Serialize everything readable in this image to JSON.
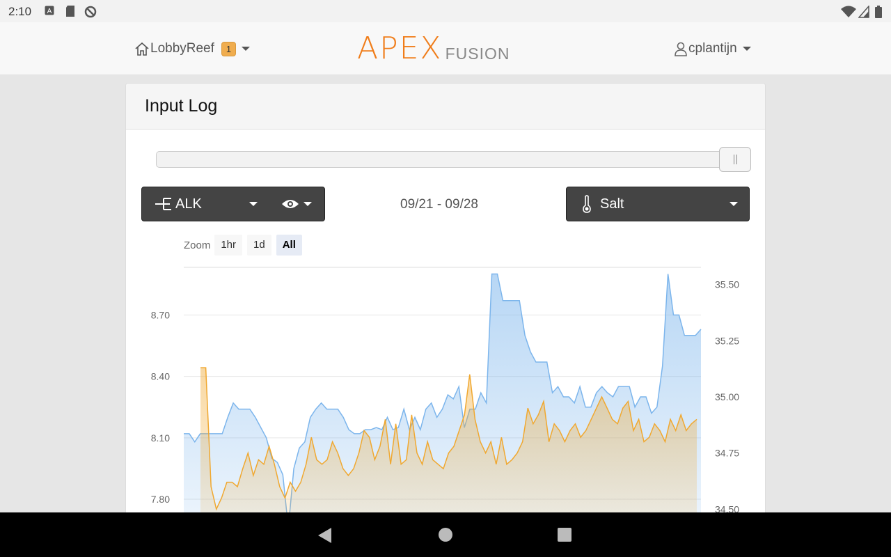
{
  "status_bar": {
    "time": "2:10"
  },
  "header": {
    "location": "LobbyReef",
    "notification_count": "1",
    "logo_main": "APEX",
    "logo_sub": "FUSION",
    "username": "cplantijn"
  },
  "card": {
    "title": "Input Log",
    "left_select": "ALK",
    "date_range": "09/21 - 09/28",
    "right_select": "Salt",
    "zoom_label": "Zoom",
    "zoom_options": [
      "1hr",
      "1d",
      "All"
    ],
    "zoom_active": "All"
  },
  "colors": {
    "accent": "#f07d1a",
    "blue_series": "#7cb5ec",
    "orange_series": "#f0a830"
  },
  "chart_data": {
    "type": "area",
    "x_range": [
      "09/21",
      "09/28"
    ],
    "y_left": {
      "ticks": [
        "8.70",
        "8.40",
        "8.10",
        "7.80"
      ],
      "ylim": [
        7.62,
        8.98
      ]
    },
    "y_right": {
      "ticks": [
        "35.50",
        "35.25",
        "35.00",
        "34.75",
        "34.50"
      ],
      "ylim": [
        34.38,
        35.62
      ]
    },
    "series": [
      {
        "axis": "left",
        "color": "#7cb5ec",
        "values": [
          8.12,
          8.12,
          8.08,
          8.12,
          8.12,
          8.12,
          8.12,
          8.12,
          8.2,
          8.27,
          8.24,
          8.24,
          8.24,
          8.2,
          8.15,
          8.1,
          8.0,
          7.98,
          7.92,
          7.66,
          7.95,
          8.05,
          8.08,
          8.2,
          8.24,
          8.27,
          8.24,
          8.24,
          8.24,
          8.2,
          8.14,
          8.12,
          8.12,
          8.14,
          8.14,
          8.15,
          8.14,
          8.2,
          8.14,
          8.15,
          8.24,
          8.14,
          8.2,
          8.14,
          8.24,
          8.27,
          8.2,
          8.24,
          8.31,
          8.29,
          8.35,
          8.15,
          8.24,
          8.24,
          8.32,
          8.27,
          8.9,
          8.9,
          8.77,
          8.77,
          8.77,
          8.77,
          8.6,
          8.52,
          8.47,
          8.47,
          8.47,
          8.32,
          8.35,
          8.3,
          8.3,
          8.27,
          8.35,
          8.25,
          8.25,
          8.32,
          8.35,
          8.32,
          8.3,
          8.35,
          8.35,
          8.35,
          8.25,
          8.3,
          8.3,
          8.22,
          8.25,
          8.45,
          8.9,
          8.7,
          8.7,
          8.6,
          8.6,
          8.6,
          8.63
        ]
      },
      {
        "axis": "right",
        "color": "#f0a830",
        "values": [
          35.13,
          35.13,
          34.6,
          34.5,
          34.55,
          34.62,
          34.62,
          34.6,
          34.68,
          34.75,
          34.65,
          34.72,
          34.7,
          34.78,
          34.7,
          34.6,
          34.55,
          34.62,
          34.58,
          34.62,
          34.7,
          34.82,
          34.72,
          34.7,
          34.72,
          34.8,
          34.75,
          34.68,
          34.65,
          34.68,
          34.75,
          34.85,
          34.82,
          34.72,
          34.78,
          34.9,
          34.7,
          34.88,
          34.7,
          34.72,
          34.92,
          34.75,
          34.7,
          34.8,
          34.72,
          34.7,
          34.68,
          34.75,
          34.78,
          34.85,
          34.92,
          35.1,
          34.9,
          34.8,
          34.75,
          34.8,
          34.7,
          34.82,
          34.7,
          34.72,
          34.75,
          34.8,
          34.95,
          34.88,
          34.92,
          34.98,
          34.8,
          34.88,
          34.85,
          34.8,
          34.85,
          34.88,
          34.82,
          34.85,
          34.9,
          34.95,
          35.0,
          34.95,
          34.9,
          34.88,
          34.95,
          34.98,
          34.85,
          34.9,
          34.8,
          34.82,
          34.88,
          34.85,
          34.8,
          34.9,
          34.85,
          34.92,
          34.85,
          34.88,
          34.9
        ]
      }
    ]
  }
}
